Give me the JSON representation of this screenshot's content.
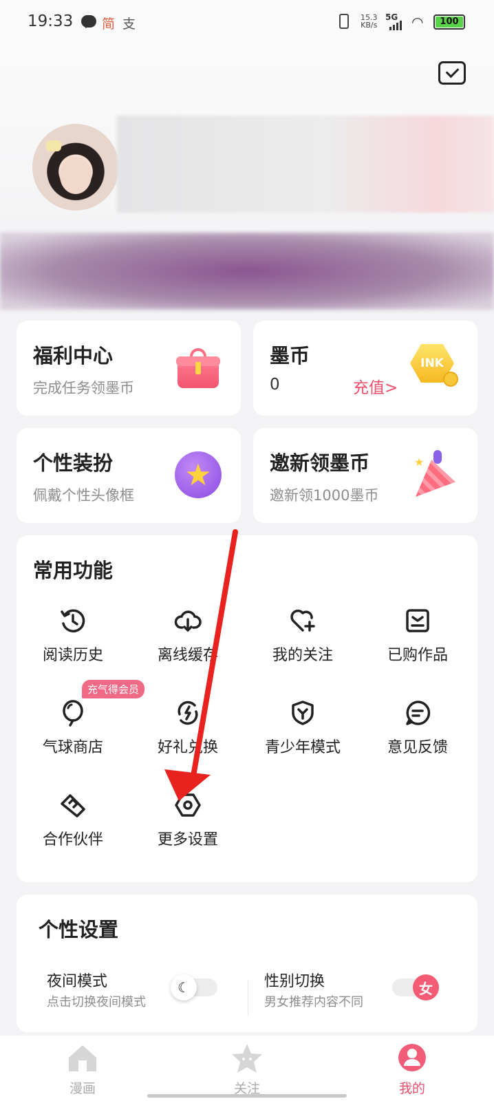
{
  "status_bar": {
    "time": "19:33",
    "indicator_jian": "简",
    "indicator_zhi": "支",
    "net_speed_value": "15.3",
    "net_speed_unit": "KB/s",
    "network": "5G",
    "battery": "100"
  },
  "profile": {
    "avatar_icon": "user-avatar"
  },
  "cards": {
    "welfare": {
      "title": "福利中心",
      "subtitle": "完成任务领墨币",
      "icon": "gift-icon"
    },
    "ink": {
      "title": "墨币",
      "value": "0",
      "link": "充值>",
      "badge_text": "INK",
      "icon": "ink-coin-icon"
    },
    "dressup": {
      "title": "个性装扮",
      "subtitle": "佩戴个性头像框",
      "icon": "star-icon"
    },
    "invite": {
      "title": "邀新领墨币",
      "subtitle": "邀新领1000墨币",
      "icon": "party-popper-icon"
    }
  },
  "common_functions": {
    "title": "常用功能",
    "items": [
      {
        "label": "阅读历史",
        "icon": "history-icon"
      },
      {
        "label": "离线缓存",
        "icon": "cloud-download-icon"
      },
      {
        "label": "我的关注",
        "icon": "heart-plus-icon"
      },
      {
        "label": "已购作品",
        "icon": "purchased-icon"
      },
      {
        "label": "气球商店",
        "icon": "balloon-icon",
        "badge": "充气得会员"
      },
      {
        "label": "好礼兑换",
        "icon": "exchange-icon"
      },
      {
        "label": "青少年模式",
        "icon": "shield-icon"
      },
      {
        "label": "意见反馈",
        "icon": "feedback-icon"
      },
      {
        "label": "合作伙伴",
        "icon": "handshake-icon"
      },
      {
        "label": "更多设置",
        "icon": "settings-hexagon-icon"
      }
    ]
  },
  "personal_settings": {
    "title": "个性设置",
    "night_mode": {
      "label": "夜间模式",
      "sub": "点击切换夜间模式",
      "icon": "moon-icon"
    },
    "gender_switch": {
      "label": "性别切换",
      "sub": "男女推荐内容不同",
      "knob_text": "女"
    }
  },
  "tab_bar": {
    "tabs": [
      {
        "label": "漫画",
        "icon": "home-icon",
        "active": false
      },
      {
        "label": "关注",
        "icon": "star-face-icon",
        "active": false
      },
      {
        "label": "我的",
        "icon": "profile-icon",
        "active": true
      }
    ]
  },
  "colors": {
    "accent": "#ef4f6a",
    "arrow": "#e8231f",
    "background": "#f3f3f5"
  }
}
